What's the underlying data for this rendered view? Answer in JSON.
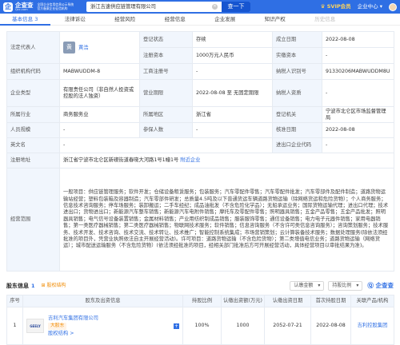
{
  "header": {
    "logo_char": "企",
    "logo_name": "企查查",
    "logo_domain": "Qcc.com",
    "official_line1": "全国企业信用信息公示系统",
    "official_line2": "官方备案企业征信机构",
    "search_value": "浙江吉速供应链管理有限公司",
    "search_button": "查一下",
    "vip_label": "SVIP会员",
    "enterprise_label": "企业中心"
  },
  "tabs": [
    "基本信息 3",
    "法律诉讼",
    "经营风险",
    "经营信息",
    "企业发展",
    "知识产权",
    "历史信息"
  ],
  "basic": {
    "legal_rep_label": "法定代表人",
    "legal_rep_avatar": "黄",
    "legal_rep_name": "黄浩",
    "status_label": "登记状态",
    "status_value": "存续",
    "established_label": "成立日期",
    "established_value": "2022-08-08",
    "capital_label": "注册资本",
    "capital_value": "1000万元人民币",
    "paidin_label": "实缴资本",
    "paidin_value": "-",
    "org_code_label": "组织机构代码",
    "org_code_value": "MABWUDDM-8",
    "reg_no_label": "工商注册号",
    "reg_no_value": "-",
    "taxpayer_label": "纳税人识别号",
    "taxpayer_value": "91330206MABWUDDM8U",
    "type_label": "企业类型",
    "type_value": "有限责任公司（非自然人投资或控股的法人独资）",
    "term_label": "营业期限",
    "term_value": "2022-08-08 至 无固定期限",
    "qual_label": "纳税人资质",
    "qual_value": "-",
    "industry_label": "所属行业",
    "industry_value": "商务服务业",
    "region_label": "所属地区",
    "region_value": "浙江省",
    "authority_label": "登记机关",
    "authority_value": "宁波市北仑区市场监督管理局",
    "scale_label": "人员规模",
    "scale_value": "-",
    "insured_label": "参保人数",
    "insured_value": "-",
    "approval_label": "核准日期",
    "approval_value": "2022-08-08",
    "english_label": "英文名",
    "english_value": "-",
    "import_label": "进出口企业代码",
    "import_value": "-",
    "address_label": "注册地址",
    "address_value": "浙江省宁波市北仑区新碶街道春晓大河路1号1幢1号",
    "address_nearby": "附近企业",
    "scope_label": "经营范围",
    "scope_value": "一般项目：供应链管理服务；软件开发；仓储设备租赁服务；包装服务；汽车零配件零售；汽车零配件批发；汽车零部件及配件制造；道路货物运输站经营；塑料包装箱及容器制造；汽车零部件研发；总质量4.5吨及以下普通货运车辆道路货物运输（除网络货运和危险货物）；个人商务服务；信息技术咨询服务；停车场服务；装卸搬运；二手车经纪；成品油批发（不含危险化学品）；无船承运业务；国际货物运输代理；进出口代理；技术进出口；货物进出口；新能源汽车整车销售；新能源汽车电附件销售；摩托车及零配件零售；照明器具销售；五金产品零售；五金产品批发；照明器具销售；电气信号设备装置销售；金属材料销售；产业用纺织制成品销售；服装服饰零售；通信设备销售；电力电子元器件销售；家用电器销售；第一类医疗器械销售；第二类医疗器械销售；物联网技术服务；软件销售；信息咨询服务（不含许可类信息咨询服务）；咨询策划服务；技术服务、技术开发、技术咨询、技术交流、技术转让、技术推广；智能控制系统集成；市场营销策划；云计算装备技术服务；数据处理服务(除依法须经批准的项目外，凭营业执照依法自主开展经营活动)。许可项目：道路货物运输（不含危险货物）；第二类增值电信业务；道路货物运输（网络货运）；城市配送运输服务（不含危险货物）(依法须经批准的项目，经相关部门批准后方可开展经营活动，具体经营项目以审批结果为准)。"
  },
  "shareholders": {
    "title": "股东信息",
    "count": "1",
    "relation": "股权结构",
    "filter1": "认缴金额",
    "filter2": "持股比例",
    "watermark": "企查查",
    "headers": [
      "序号",
      "股东及出资信息",
      "持股比例",
      "认缴出资额(万元)",
      "认缴出资日期",
      "首次持股日期",
      "关联产品/机构"
    ],
    "rows": [
      {
        "index": "1",
        "logo_text": "GEELY",
        "name": "吉利汽车集团有限公司",
        "tag": "大股东",
        "equity_link": "股权结构 >",
        "ratio": "100%",
        "amount": "1000",
        "subscribe_date": "2052-07-21",
        "first_date": "2022-08-08",
        "related": "吉利控股集团"
      }
    ]
  }
}
